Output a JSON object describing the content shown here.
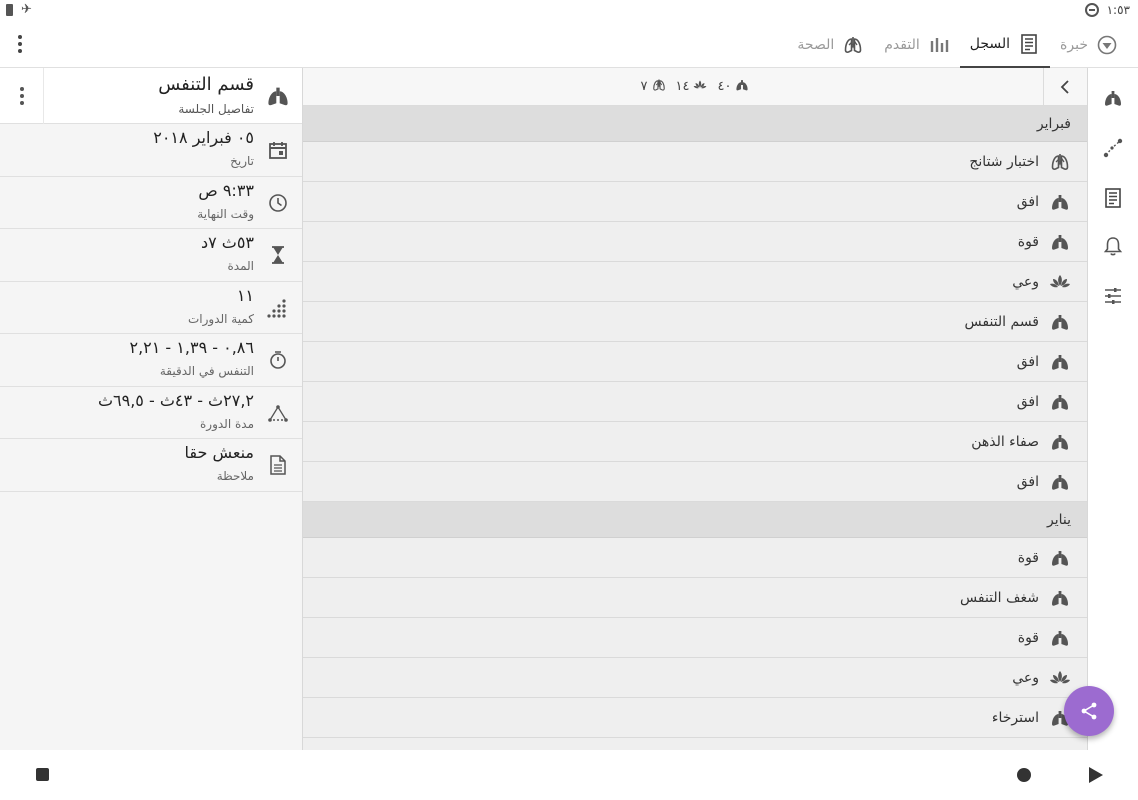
{
  "status_bar": {
    "time": "١:٥٣"
  },
  "tabs": [
    {
      "label": "خبرة",
      "icon": "compass-icon"
    },
    {
      "label": "السجل",
      "icon": "log-icon"
    },
    {
      "label": "التقدم",
      "icon": "bar-chart-icon"
    },
    {
      "label": "الصحة",
      "icon": "health-icon"
    }
  ],
  "active_tab_index": 1,
  "rail": [
    {
      "icon": "lungs-icon"
    },
    {
      "icon": "path-icon"
    },
    {
      "icon": "log-icon"
    },
    {
      "icon": "bell-icon"
    },
    {
      "icon": "sliders-icon"
    }
  ],
  "summary": {
    "breath_count": "٤٠",
    "meditation_count": "١٤",
    "health_count": "٧"
  },
  "sections": [
    {
      "month": "فبراير",
      "rows": [
        {
          "label": "اختبار شتانج",
          "icon": "health-icon"
        },
        {
          "label": "افق",
          "icon": "lungs-icon"
        },
        {
          "label": "قوة",
          "icon": "lungs-icon"
        },
        {
          "label": "وعي",
          "icon": "lotus-icon"
        },
        {
          "label": "قسم التنفس",
          "icon": "lungs-icon"
        },
        {
          "label": "افق",
          "icon": "lungs-icon"
        },
        {
          "label": "افق",
          "icon": "lungs-icon"
        },
        {
          "label": "صفاء الذهن",
          "icon": "lungs-icon"
        },
        {
          "label": "افق",
          "icon": "lungs-icon"
        }
      ]
    },
    {
      "month": "يناير",
      "rows": [
        {
          "label": "قوة",
          "icon": "lungs-icon"
        },
        {
          "label": "شغف التنفس",
          "icon": "lungs-icon"
        },
        {
          "label": "قوة",
          "icon": "lungs-icon"
        },
        {
          "label": "وعي",
          "icon": "lotus-icon"
        },
        {
          "label": "استرخاء",
          "icon": "lungs-icon"
        }
      ]
    }
  ],
  "detail": {
    "title": "قسم التنفس",
    "subtitle": "تفاصيل الجلسة",
    "fields": [
      {
        "value": "٠٥ فبراير ٢٠١٨",
        "label": "تاريخ",
        "icon": "calendar-icon"
      },
      {
        "value": "٩:٣٣ ص",
        "label": "وقت النهاية",
        "icon": "clock-icon"
      },
      {
        "value": "٥٣ث ٧د",
        "label": "المدة",
        "icon": "hourglass-icon"
      },
      {
        "value": "١١",
        "label": "كمية الدورات",
        "icon": "dots-grid-icon"
      },
      {
        "value": "٠,٨٦ - ١,٣٩ - ٢,٢١",
        "label": "التنفس في الدقيقة",
        "icon": "stopwatch-icon"
      },
      {
        "value": "٢٧,٢ث - ٤٣ث - ٦٩,٥ث",
        "label": "مدة الدورة",
        "icon": "graph-icon"
      },
      {
        "value": "منعش حقا",
        "label": "ملاحظة",
        "icon": "note-icon"
      }
    ]
  },
  "colors": {
    "fab": "#9c6bd0",
    "icon": "#555555",
    "month_bg": "#dddddd",
    "list_bg": "#efefef"
  }
}
